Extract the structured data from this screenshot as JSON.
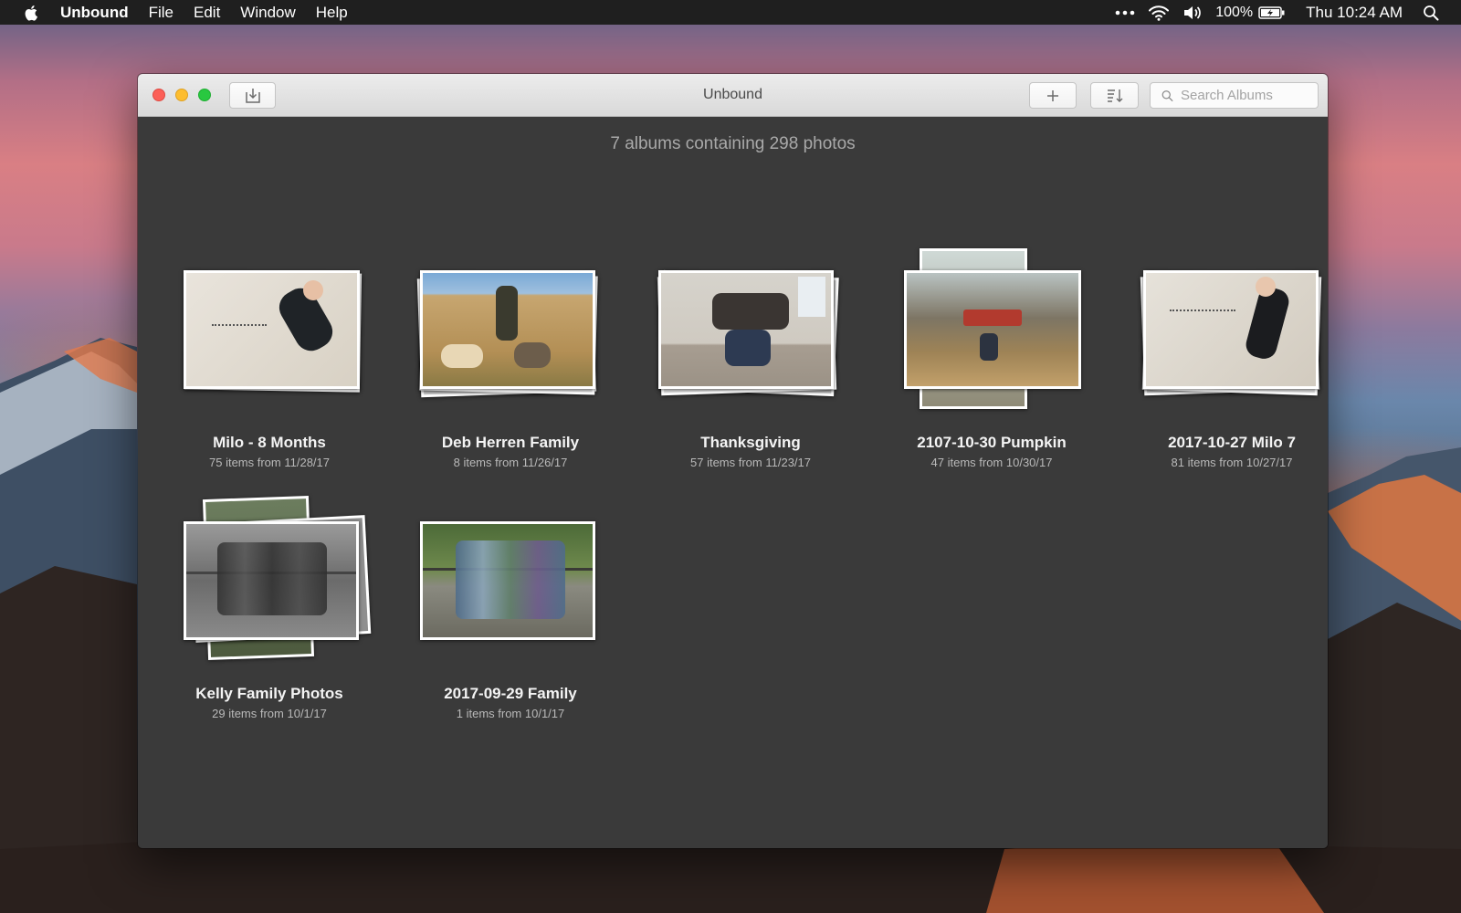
{
  "menubar": {
    "app_name": "Unbound",
    "items": [
      "File",
      "Edit",
      "Window",
      "Help"
    ],
    "battery": "100%",
    "clock": "Thu 10:24 AM",
    "icons": [
      "apple-icon",
      "more-icon",
      "wifi-icon",
      "volume-icon",
      "battery-icon",
      "spotlight-icon"
    ]
  },
  "window": {
    "title": "Unbound",
    "search_placeholder": "Search Albums",
    "summary": "7 albums containing 298 photos"
  },
  "albums": [
    {
      "title": "Milo - 8 Months",
      "subtitle": "75 items from 11/28/17"
    },
    {
      "title": "Deb Herren Family",
      "subtitle": "8 items from 11/26/17"
    },
    {
      "title": "Thanksgiving",
      "subtitle": "57 items from 11/23/17"
    },
    {
      "title": "2107-10-30 Pumpkin",
      "subtitle": "47 items from 10/30/17"
    },
    {
      "title": "2017-10-27 Milo 7",
      "subtitle": "81 items from 10/27/17"
    },
    {
      "title": "Kelly Family Photos",
      "subtitle": "29 items from 10/1/17"
    },
    {
      "title": "2017-09-29 Family",
      "subtitle": "1 items from 10/1/17"
    }
  ],
  "colors": {
    "window_background": "#3a3a3a",
    "menubar": "#1f1f1f",
    "close": "#fc5f57",
    "minimize": "#fdbd2e",
    "maximize": "#29c840"
  }
}
